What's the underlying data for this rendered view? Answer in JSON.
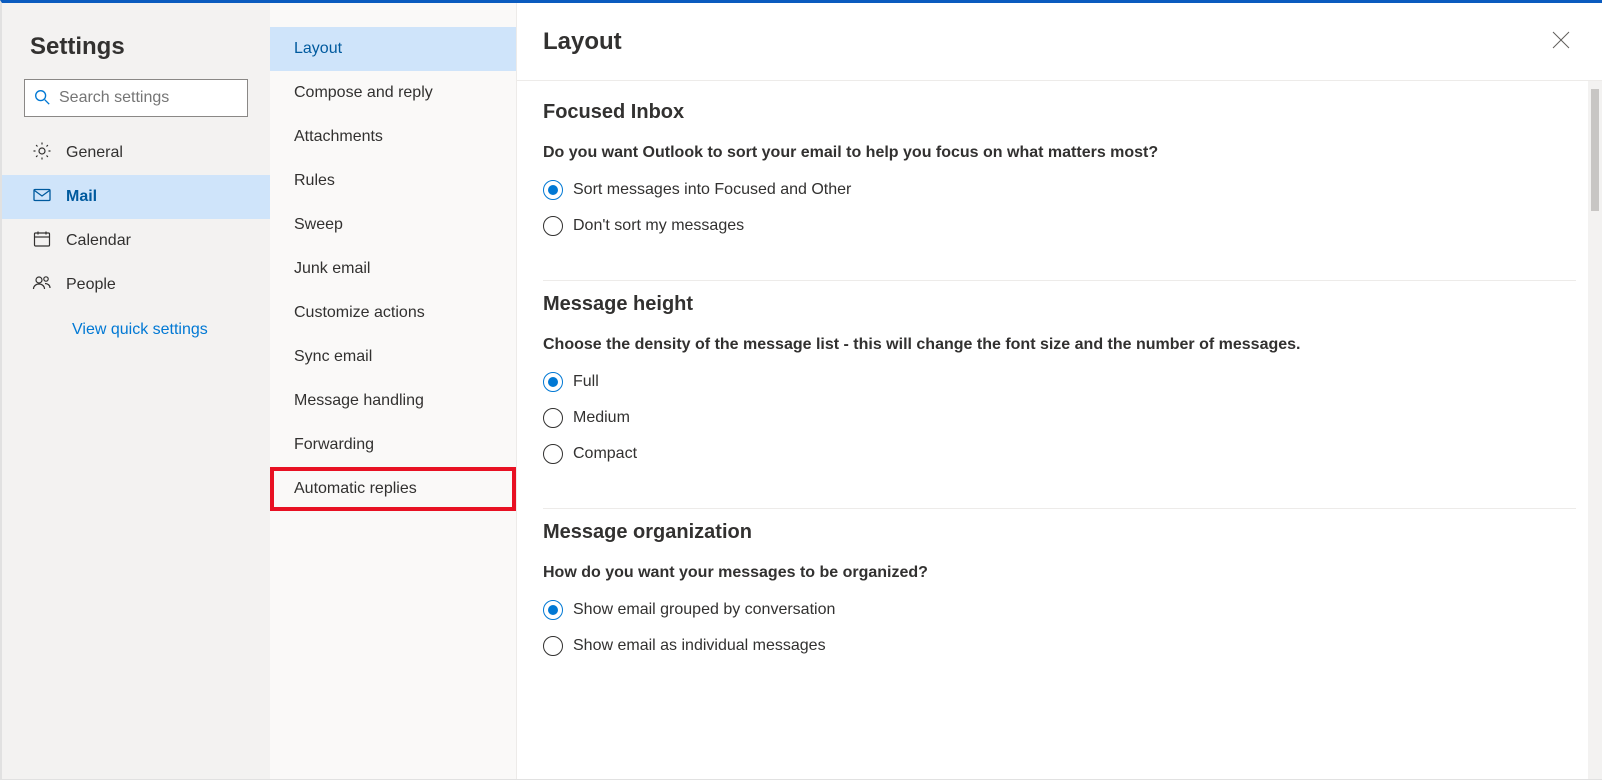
{
  "sidebar": {
    "title": "Settings",
    "search_placeholder": "Search settings",
    "items": [
      {
        "key": "general",
        "label": "General",
        "selected": false
      },
      {
        "key": "mail",
        "label": "Mail",
        "selected": true
      },
      {
        "key": "calendar",
        "label": "Calendar",
        "selected": false
      },
      {
        "key": "people",
        "label": "People",
        "selected": false
      }
    ],
    "quick_link": "View quick settings"
  },
  "subnav": {
    "items": [
      {
        "label": "Layout",
        "selected": true,
        "highlighted": false
      },
      {
        "label": "Compose and reply",
        "selected": false,
        "highlighted": false
      },
      {
        "label": "Attachments",
        "selected": false,
        "highlighted": false
      },
      {
        "label": "Rules",
        "selected": false,
        "highlighted": false
      },
      {
        "label": "Sweep",
        "selected": false,
        "highlighted": false
      },
      {
        "label": "Junk email",
        "selected": false,
        "highlighted": false
      },
      {
        "label": "Customize actions",
        "selected": false,
        "highlighted": false
      },
      {
        "label": "Sync email",
        "selected": false,
        "highlighted": false
      },
      {
        "label": "Message handling",
        "selected": false,
        "highlighted": false
      },
      {
        "label": "Forwarding",
        "selected": false,
        "highlighted": false
      },
      {
        "label": "Automatic replies",
        "selected": false,
        "highlighted": true
      }
    ]
  },
  "main": {
    "title": "Layout",
    "sections": [
      {
        "heading": "Focused Inbox",
        "desc": "Do you want Outlook to sort your email to help you focus on what matters most?",
        "options": [
          {
            "label": "Sort messages into Focused and Other",
            "checked": true
          },
          {
            "label": "Don't sort my messages",
            "checked": false
          }
        ]
      },
      {
        "heading": "Message height",
        "desc": "Choose the density of the message list - this will change the font size and the number of messages.",
        "options": [
          {
            "label": "Full",
            "checked": true
          },
          {
            "label": "Medium",
            "checked": false
          },
          {
            "label": "Compact",
            "checked": false
          }
        ]
      },
      {
        "heading": "Message organization",
        "desc": "How do you want your messages to be organized?",
        "options": [
          {
            "label": "Show email grouped by conversation",
            "checked": true
          },
          {
            "label": "Show email as individual messages",
            "checked": false
          }
        ]
      }
    ]
  }
}
